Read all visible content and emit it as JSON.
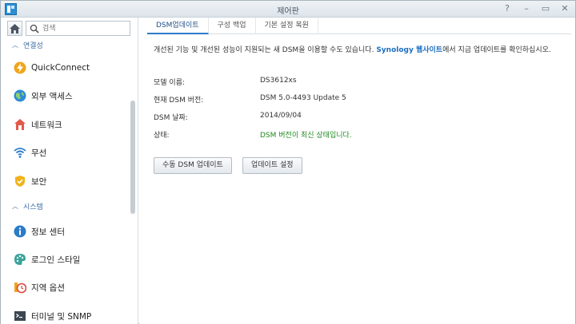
{
  "window": {
    "title": "제어판"
  },
  "window_controls": [
    "?",
    "–",
    "▭",
    "✕"
  ],
  "search": {
    "placeholder": "검색"
  },
  "sidebar": {
    "section_connectivity": "연결성",
    "section_system": "시스템",
    "items": [
      {
        "label": "QuickConnect",
        "icon": "quickconnect-icon"
      },
      {
        "label": "외부 액세스",
        "icon": "globe-icon"
      },
      {
        "label": "네트워크",
        "icon": "network-house-icon"
      },
      {
        "label": "무선",
        "icon": "wifi-icon"
      },
      {
        "label": "보안",
        "icon": "shield-icon"
      },
      {
        "label": "정보 센터",
        "icon": "info-icon"
      },
      {
        "label": "로그인 스타일",
        "icon": "palette-icon"
      },
      {
        "label": "지역 옵션",
        "icon": "clock-icon"
      },
      {
        "label": "터미널 및 SNMP",
        "icon": "terminal-icon"
      }
    ]
  },
  "tabs": [
    "DSM업데이트",
    "구성 백업",
    "기본 설정 복원"
  ],
  "main": {
    "description_pre": "개선된 기능 및 개선된 성능이 지원되는 새 DSM을 이용할 수도 있습니다. ",
    "description_link": "Synology 웹사이트",
    "description_post": "에서 지금 업데이트를 확인하십시오.",
    "model_label": "모델 이름:",
    "model_value": "DS3612xs",
    "version_label": "현재 DSM 버전:",
    "version_value": "DSM 5.0-4493 Update 5",
    "date_label": "DSM 날짜:",
    "date_value": "2014/09/04",
    "status_label": "상태:",
    "status_value": "DSM 버전이 최신 상태입니다.",
    "manual_update_button": "수동 DSM 업데이트",
    "update_settings_button": "업데이트 설정"
  },
  "colors": {
    "accent": "#2a7bc8",
    "link": "#1d6fc0",
    "status_ok": "#1f8a1f"
  }
}
